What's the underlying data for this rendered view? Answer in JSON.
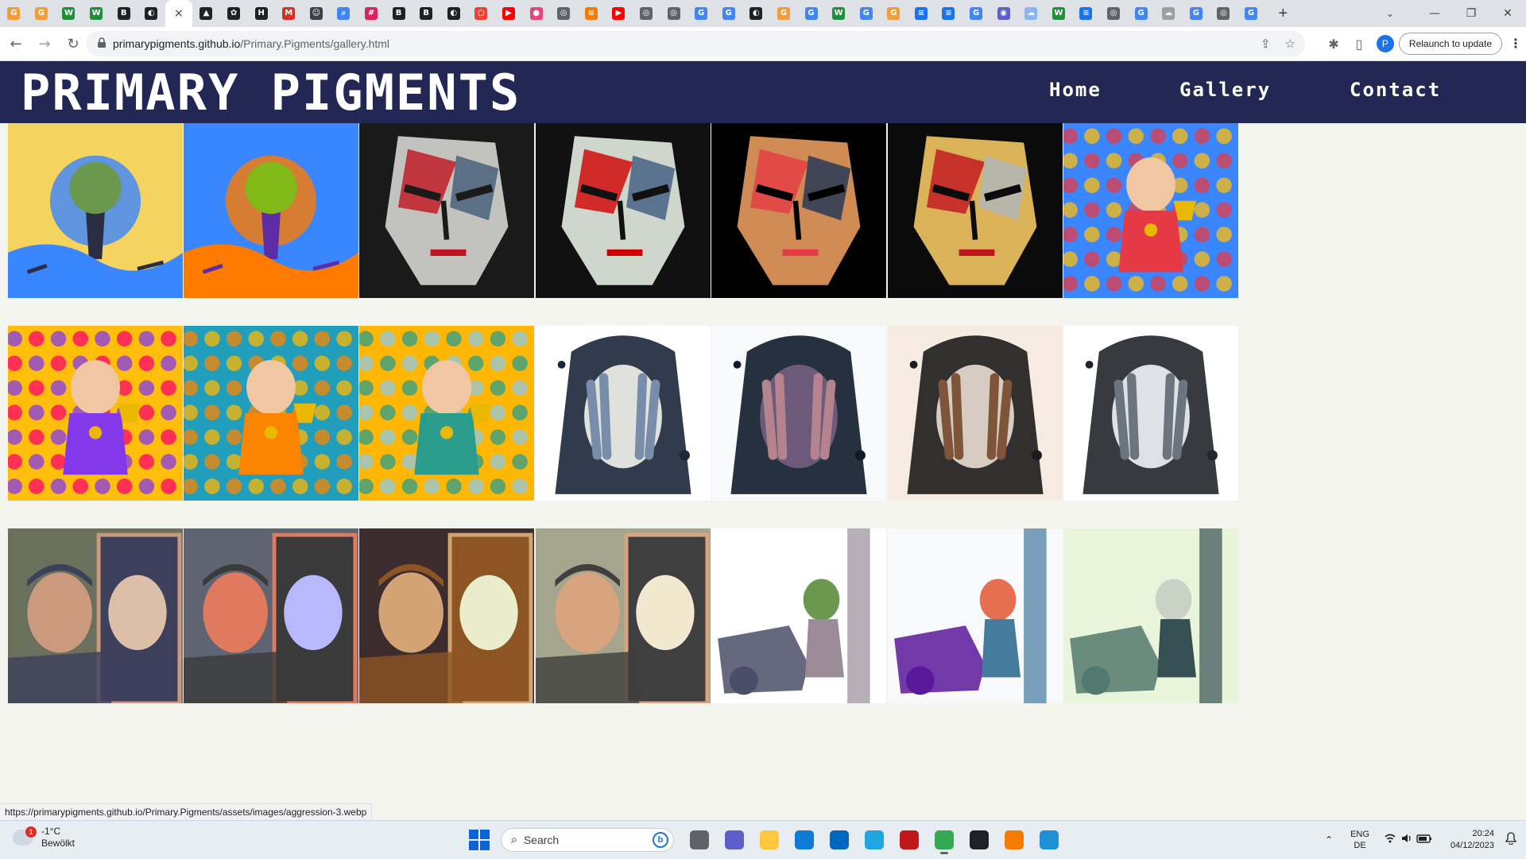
{
  "browser": {
    "tabs": [
      {
        "icon": "g-orange-icon",
        "color": "#f29d38",
        "glyph": "G"
      },
      {
        "icon": "g-orange-icon",
        "color": "#f29d38",
        "glyph": "G"
      },
      {
        "icon": "w-green-icon",
        "color": "#1f8f3a",
        "glyph": "W"
      },
      {
        "icon": "w-green-icon",
        "color": "#1f8f3a",
        "glyph": "W"
      },
      {
        "icon": "b-black-icon",
        "color": "#202124",
        "glyph": "B"
      },
      {
        "icon": "github-icon",
        "color": "#202124",
        "glyph": "◐"
      },
      {
        "icon": "close-icon",
        "color": "",
        "glyph": "×",
        "active": true
      },
      {
        "icon": "bird-icon",
        "color": "#202124",
        "glyph": "▲"
      },
      {
        "icon": "openai-icon",
        "color": "#202124",
        "glyph": "✿"
      },
      {
        "icon": "hf-icon",
        "color": "#202124",
        "glyph": "H"
      },
      {
        "icon": "gmail-icon",
        "color": "#d93025",
        "glyph": "M"
      },
      {
        "icon": "smile-icon",
        "color": "#3c4043",
        "glyph": "☺"
      },
      {
        "icon": "search-icon",
        "color": "#4285f4",
        "glyph": "⌕"
      },
      {
        "icon": "slack-icon",
        "color": "#e01e5a",
        "glyph": "#"
      },
      {
        "icon": "b-black-icon",
        "color": "#202124",
        "glyph": "B"
      },
      {
        "icon": "b-black-icon",
        "color": "#202124",
        "glyph": "B"
      },
      {
        "icon": "github-icon",
        "color": "#202124",
        "glyph": "◐"
      },
      {
        "icon": "red-ring-icon",
        "color": "#ea4335",
        "glyph": "○"
      },
      {
        "icon": "youtube-icon",
        "color": "#ff0000",
        "glyph": "▶"
      },
      {
        "icon": "pink-icon",
        "color": "#e8447a",
        "glyph": "●"
      },
      {
        "icon": "globe-icon",
        "color": "#5f6368",
        "glyph": "◎"
      },
      {
        "icon": "orange-icon",
        "color": "#f57c00",
        "glyph": "≋"
      },
      {
        "icon": "youtube-icon",
        "color": "#ff0000",
        "glyph": "▶"
      },
      {
        "icon": "globe-icon",
        "color": "#5f6368",
        "glyph": "◎"
      },
      {
        "icon": "globe-icon",
        "color": "#5f6368",
        "glyph": "◎"
      },
      {
        "icon": "google-icon",
        "color": "#4285f4",
        "glyph": "G"
      },
      {
        "icon": "google-icon",
        "color": "#4285f4",
        "glyph": "G"
      },
      {
        "icon": "github-icon",
        "color": "#202124",
        "glyph": "◐"
      },
      {
        "icon": "g-orange-icon",
        "color": "#f29d38",
        "glyph": "G"
      },
      {
        "icon": "google-icon",
        "color": "#4285f4",
        "glyph": "G"
      },
      {
        "icon": "w-green-icon",
        "color": "#1f8f3a",
        "glyph": "W"
      },
      {
        "icon": "google-icon",
        "color": "#4285f4",
        "glyph": "G"
      },
      {
        "icon": "g-orange-icon",
        "color": "#f29d38",
        "glyph": "G"
      },
      {
        "icon": "docs-icon",
        "color": "#1a73e8",
        "glyph": "≡"
      },
      {
        "icon": "docs-icon",
        "color": "#1a73e8",
        "glyph": "≡"
      },
      {
        "icon": "google-icon",
        "color": "#4285f4",
        "glyph": "G"
      },
      {
        "icon": "blue-ring-icon",
        "color": "#5b5fc7",
        "glyph": "◉"
      },
      {
        "icon": "cloud-icon",
        "color": "#8ab4f8",
        "glyph": "☁"
      },
      {
        "icon": "w-green-icon",
        "color": "#1f8f3a",
        "glyph": "W"
      },
      {
        "icon": "docs-icon",
        "color": "#1a73e8",
        "glyph": "≡"
      },
      {
        "icon": "globe-icon",
        "color": "#5f6368",
        "glyph": "◎"
      },
      {
        "icon": "google-icon",
        "color": "#4285f4",
        "glyph": "G"
      },
      {
        "icon": "cloud-icon",
        "color": "#9aa0a6",
        "glyph": "☁"
      },
      {
        "icon": "google-icon",
        "color": "#4285f4",
        "glyph": "G"
      },
      {
        "icon": "globe-icon",
        "color": "#5f6368",
        "glyph": "◎"
      },
      {
        "icon": "google-icon",
        "color": "#4285f4",
        "glyph": "G"
      }
    ],
    "new_tab": "+",
    "tab_search": "⌄",
    "window_controls": {
      "minimize": "—",
      "maximize": "❐",
      "close": "✕"
    },
    "nav": {
      "back": "←",
      "forward": "→",
      "reload": "↻"
    },
    "url_host": "primarypigments.github.io",
    "url_path": "/Primary.Pigments/gallery.html",
    "omnibox_icons": {
      "share": "⇪",
      "bookmark": "☆"
    },
    "extensions": "✱",
    "sidepanel": "▯",
    "profile_initial": "P",
    "relaunch_label": "Relaunch to update",
    "menu": "⋮",
    "status_url": "https://primarypigments.github.io/Primary.Pigments/assets/images/aggression-3.webp"
  },
  "site": {
    "title": "PRIMARY PIGMENTS",
    "nav": [
      "Home",
      "Gallery",
      "Contact"
    ],
    "colors": {
      "header": "#232754",
      "background": "#f3f4ee"
    }
  },
  "gallery": {
    "rows": [
      [
        {
          "subject": "earth-tree-harmony",
          "palette": [
            "#f4d35e",
            "#6a994e",
            "#3a86ff",
            "#2b2d42"
          ]
        },
        {
          "subject": "peace-sign-river",
          "palette": [
            "#3a86ff",
            "#80b918",
            "#ff7b00",
            "#5e2ca5"
          ]
        },
        {
          "subject": "angry-face-palette-knife",
          "palette": [
            "#1a1a1a",
            "#c1121f",
            "#415a77",
            "#e0e1dd"
          ]
        },
        {
          "subject": "angry-face-palette-knife",
          "palette": [
            "#111111",
            "#d00000",
            "#3d5a80",
            "#f1faee"
          ]
        },
        {
          "subject": "angry-face-palette-knife",
          "palette": [
            "#000000",
            "#e63946",
            "#1d3557",
            "#f4a261"
          ]
        },
        {
          "subject": "angry-face-palette-knife",
          "palette": [
            "#0b0b0b",
            "#c1121f",
            "#adb5bd",
            "#ffd166"
          ]
        },
        {
          "subject": "child-trophy-applause",
          "palette": [
            "#ffbe0b",
            "#3a86ff",
            "#e63946",
            "#8ecae6"
          ]
        }
      ],
      [
        {
          "subject": "girl-trophy-crowd",
          "palette": [
            "#ff006e",
            "#ffbe0b",
            "#8338ec",
            "#fb5607"
          ]
        },
        {
          "subject": "boy-trophy-spotlight",
          "palette": [
            "#ffb703",
            "#219ebc",
            "#fb8500",
            "#023047"
          ]
        },
        {
          "subject": "boy-medal-podium",
          "palette": [
            "#8ecae6",
            "#ffb703",
            "#2a9d8f",
            "#e76f51"
          ]
        },
        {
          "subject": "woman-hands-face-watercolor",
          "palette": [
            "#ffffff",
            "#1b263b",
            "#778da9",
            "#e0e1dd"
          ]
        },
        {
          "subject": "woman-hands-face-watercolor",
          "palette": [
            "#f8f9fa",
            "#0d1b2a",
            "#b5838d",
            "#6d597a"
          ]
        },
        {
          "subject": "woman-hands-face-watercolor",
          "palette": [
            "#f5ebe0",
            "#1c1c1c",
            "#7f5539",
            "#d6ccc2"
          ]
        },
        {
          "subject": "woman-hands-face-watercolor",
          "palette": [
            "#ffffff",
            "#212529",
            "#6c757d",
            "#dee2e6"
          ]
        }
      ],
      [
        {
          "subject": "man-mirror-reflection",
          "palette": [
            "#6b705c",
            "#3d405b",
            "#cb997e",
            "#ddbea9"
          ]
        },
        {
          "subject": "man-mirror-reflection",
          "palette": [
            "#5e6472",
            "#3a3a3a",
            "#e07a5f",
            "#b8b8ff"
          ]
        },
        {
          "subject": "man-mirror-reflection",
          "palette": [
            "#3d2c2e",
            "#8d5524",
            "#d4a373",
            "#e9edc9"
          ]
        },
        {
          "subject": "man-mirror-reflection",
          "palette": [
            "#a5a58d",
            "#3f3f3f",
            "#d8a47f",
            "#f2e8cf"
          ]
        },
        {
          "subject": "boy-car-crash-tree",
          "palette": [
            "#ffffff",
            "#4a4e69",
            "#9a8c98",
            "#6a994e"
          ]
        },
        {
          "subject": "girl-crying-car-crash",
          "palette": [
            "#f8f9fa",
            "#5a189a",
            "#457b9d",
            "#e76f51"
          ]
        },
        {
          "subject": "child-tree-crash-forest",
          "palette": [
            "#e9f5db",
            "#52796f",
            "#354f52",
            "#cad2c5"
          ]
        }
      ]
    ]
  },
  "taskbar": {
    "weather_temp": "-1°C",
    "weather_desc": "Bewölkt",
    "weather_badge": "1",
    "search_label": "Search",
    "bing": "b",
    "apps": [
      {
        "icon": "task-view-icon",
        "color": "#5f6368"
      },
      {
        "icon": "teams-icon",
        "color": "#5b5fc7"
      },
      {
        "icon": "file-explorer-icon",
        "color": "#ffc83d"
      },
      {
        "icon": "edge-icon",
        "color": "#0f7bd5"
      },
      {
        "icon": "store-icon",
        "color": "#0067c0"
      },
      {
        "icon": "chatgpt-helper-icon",
        "color": "#1fa6de"
      },
      {
        "icon": "mcafee-icon",
        "color": "#c01818"
      },
      {
        "icon": "chrome-icon",
        "color": "#34a853",
        "running": true
      },
      {
        "icon": "emoji-icon",
        "color": "#202124"
      },
      {
        "icon": "orange-app-icon",
        "color": "#f57c00"
      },
      {
        "icon": "notepad-icon",
        "color": "#1e90d6"
      }
    ],
    "tray_chevron": "⌃",
    "lang_top": "ENG",
    "lang_bottom": "DE",
    "sys_icons": "📶 🔊 🔋",
    "time": "20:24",
    "date": "04/12/2023",
    "bell": "🔔"
  }
}
